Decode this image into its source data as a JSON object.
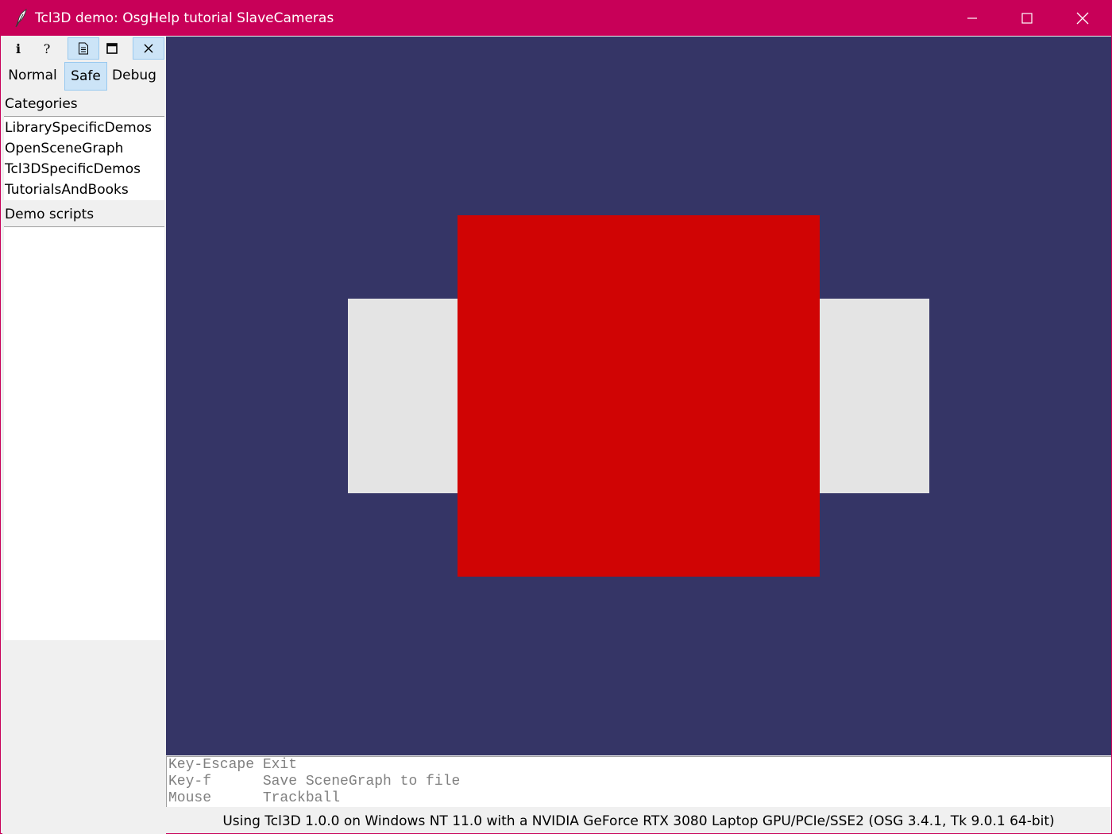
{
  "window": {
    "title": "Tcl3D demo: OsgHelp tutorial SlaveCameras",
    "accent_color": "#c80058",
    "icon": "feather-icon"
  },
  "toolbar": {
    "buttons": [
      {
        "name": "info-icon",
        "glyph": "i",
        "active": false
      },
      {
        "name": "help-icon",
        "glyph": "?",
        "active": false
      },
      {
        "name": "document-icon",
        "glyph": "",
        "active": true
      },
      {
        "name": "window-icon",
        "glyph": "",
        "active": false
      },
      {
        "name": "close-icon",
        "glyph": "",
        "active": true
      }
    ]
  },
  "modes": {
    "normal": "Normal",
    "safe": "Safe",
    "debug": "Debug",
    "selected": "Safe"
  },
  "categories": {
    "label": "Categories",
    "items": [
      "LibrarySpecificDemos",
      "OpenSceneGraph",
      "Tcl3DSpecificDemos",
      "TutorialsAndBooks"
    ]
  },
  "demo_scripts": {
    "label": "Demo scripts",
    "items": []
  },
  "viewport": {
    "background": "#353566",
    "front_color": "#d00404",
    "side_color": "#e4e4e4"
  },
  "help": {
    "lines": [
      "Key-Escape Exit",
      "Key-f      Save SceneGraph to file",
      "Mouse      Trackball"
    ]
  },
  "status": {
    "text": "Using Tcl3D 1.0.0 on Windows NT 11.0 with a NVIDIA GeForce RTX 3080 Laptop GPU/PCIe/SSE2 (OSG 3.4.1, Tk 9.0.1 64-bit)"
  }
}
